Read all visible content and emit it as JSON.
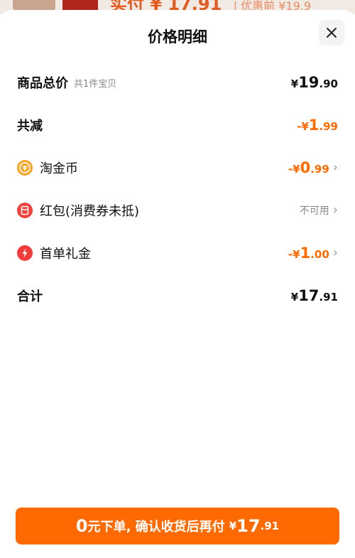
{
  "background": {
    "text_main": "实付 ¥ 17.91",
    "text_sub": "| 优惠前 ¥19.9"
  },
  "sheet": {
    "title": "价格明细"
  },
  "rows": {
    "subtotal": {
      "label": "商品总价",
      "note": "共1件宝贝",
      "currency": "¥",
      "int": "19",
      "dec": ".90"
    },
    "discount": {
      "label": "共减",
      "prefix": "-¥",
      "int": "1",
      "dec": ".99"
    },
    "coins": {
      "label": "淘金币",
      "prefix": "-¥",
      "int": "0",
      "dec": ".99"
    },
    "redpacket": {
      "label": "红包(消费券未抵)",
      "status": "不可用"
    },
    "firstorder": {
      "label": "首单礼金",
      "prefix": "-¥",
      "int": "1",
      "dec": ".00"
    },
    "total": {
      "label": "合计",
      "currency": "¥",
      "int": "17",
      "dec": ".91"
    }
  },
  "cta": {
    "zero": "0",
    "text": "元下单, 确认收货后再付",
    "currency": "¥",
    "int": "17",
    "dec": ".91"
  },
  "colors": {
    "accent": "#ff6a00",
    "coin": "#f6a623",
    "red": "#f0413a"
  },
  "icons": {
    "close": "close-icon",
    "coin": "taojinbi-coin-icon",
    "redpacket": "red-packet-icon",
    "firstorder": "lightning-icon",
    "chevron": "chevron-right-icon"
  }
}
